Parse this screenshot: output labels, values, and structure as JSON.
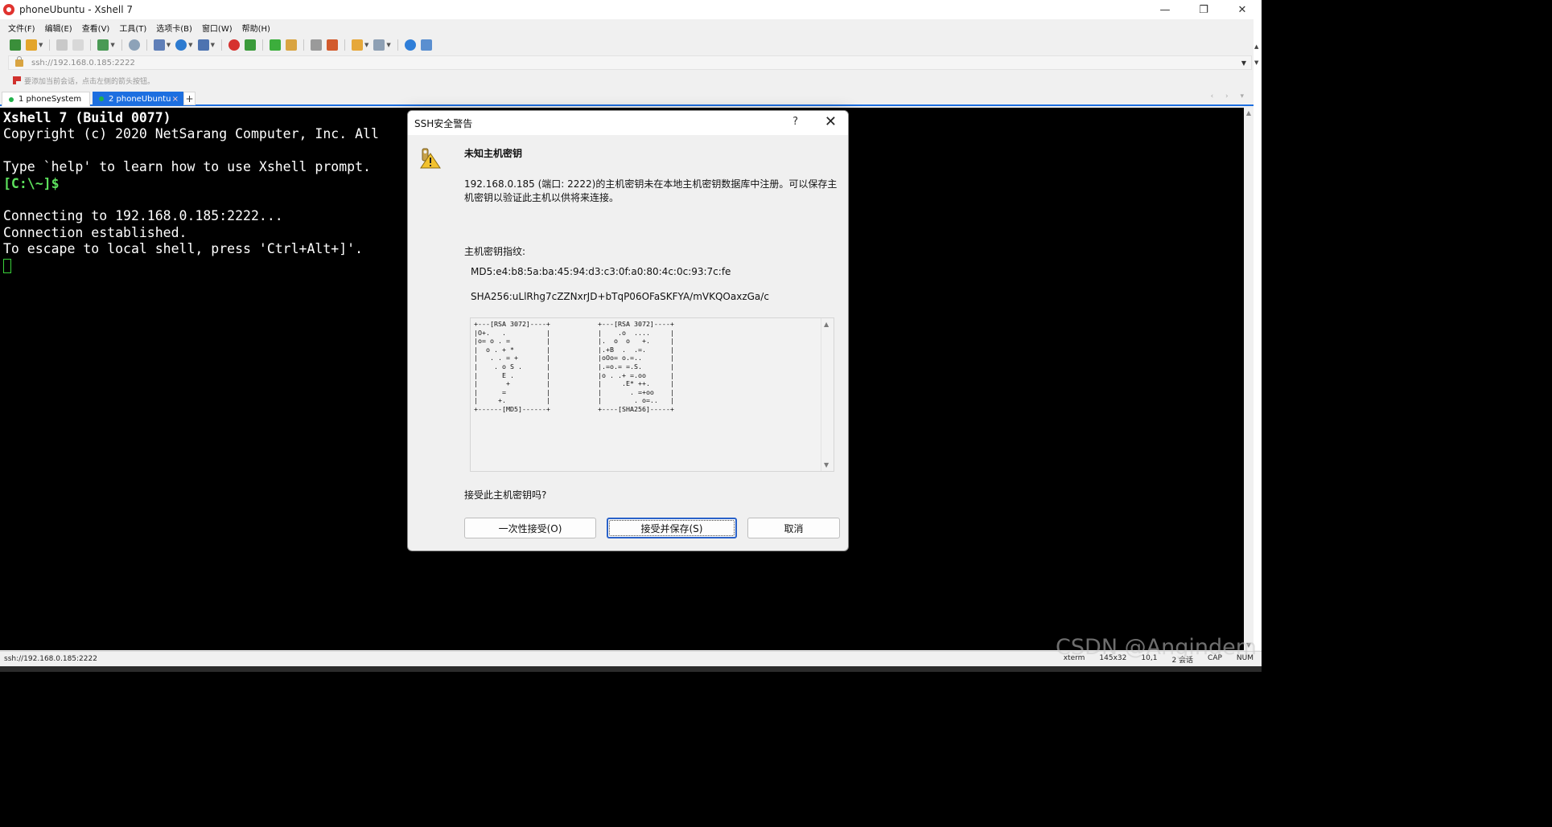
{
  "window": {
    "title": "phoneUbuntu - Xshell 7",
    "controls": [
      "—",
      "❐",
      "✕"
    ]
  },
  "menu": [
    "文件(F)",
    "编辑(E)",
    "查看(V)",
    "工具(T)",
    "选项卡(B)",
    "窗口(W)",
    "帮助(H)"
  ],
  "address": {
    "value": "ssh://192.168.0.185:2222"
  },
  "hint": {
    "text": "要添加当前会话，点击左侧的箭头按钮。"
  },
  "tabs": [
    {
      "label": "1 phoneSystem",
      "active": false
    },
    {
      "label": "2 phoneUbuntu",
      "active": true,
      "close": "×"
    }
  ],
  "tab_add": "+",
  "terminal": {
    "line1": "Xshell 7 (Build 0077)",
    "line2": "Copyright (c) 2020 NetSarang Computer, Inc. All",
    "line3": "Type `help' to learn how to use Xshell prompt.",
    "prompt": "[C:\\~]$",
    "line5": "Connecting to 192.168.0.185:2222...",
    "line6": "Connection established.",
    "line7": "To escape to local shell, press 'Ctrl+Alt+]'."
  },
  "dialog": {
    "title": "SSH安全警告",
    "help": "?",
    "close": "✕",
    "heading": "未知主机密钥",
    "message": "192.168.0.185 (端口: 2222)的主机密钥未在本地主机密钥数据库中注册。可以保存主机密钥以验证此主机以供将来连接。",
    "fingerprint_label": "主机密钥指纹:",
    "md5": "MD5:e4:b8:5a:ba:45:94:d3:c3:0f:a0:80:4c:0c:93:7c:fe",
    "sha256": "SHA256:uLlRhg7cZZNxrJD+bTqP06OFaSKFYA/mVKQOaxzGa/c",
    "art_md5": "+---[RSA 3072]----+\n|O+.   .          |\n|o= o . =         |\n|  o . + *        |\n|   . . = +       |\n|    . o S .      |\n|      E .        |\n|       +         |\n|      =          |\n|     +.          |\n+------[MD5]------+",
    "art_sha": "+---[RSA 3072]----+\n|    .o  ....     |\n|.  o  o   +.     |\n|.+B  .  .=.      |\n|oOo= o.=..       |\n|.=o.= =.S.       |\n|o . .+ =.oo      |\n|     .E* ++.     |\n|       . =+oo    |\n|        . o=..   |\n+----[SHA256]-----+",
    "question": "接受此主机密钥吗?",
    "buttons": {
      "once": "一次性接受(O)",
      "save": "接受并保存(S)",
      "cancel": "取消"
    }
  },
  "status": {
    "left": "ssh://192.168.0.185:2222",
    "right": [
      "xterm",
      "145x32",
      "10,1",
      "2 会话",
      "CAP",
      "NUM"
    ]
  },
  "watermark": "CSDN @Angindem"
}
